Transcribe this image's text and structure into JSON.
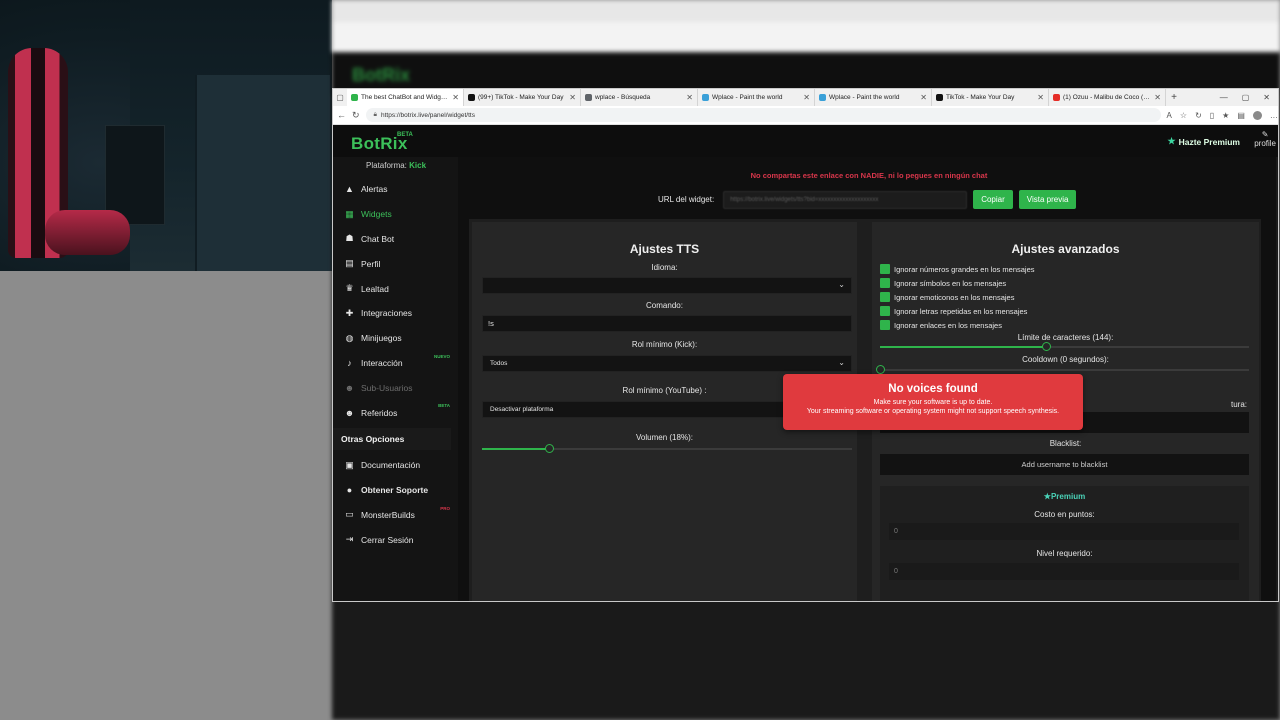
{
  "browser": {
    "tabs": [
      {
        "title": "The best ChatBot and Widgets f",
        "color": "#2fb44b",
        "active": true
      },
      {
        "title": "(99+) TikTok - Make Your Day",
        "color": "#111111",
        "active": false
      },
      {
        "title": "wplace - Búsqueda",
        "color": "#5f6368",
        "active": false
      },
      {
        "title": "Wplace - Paint the world",
        "color": "#3aa0d8",
        "active": false
      },
      {
        "title": "Wplace - Paint the world",
        "color": "#3aa0d8",
        "active": false
      },
      {
        "title": "TikTok - Make Your Day",
        "color": "#111111",
        "active": false
      },
      {
        "title": "(1) Ozuu - Malibu de Coco (Offi",
        "color": "#e52d27",
        "active": false
      }
    ],
    "url": "https://botrix.live/panel/widget/tts"
  },
  "app": {
    "logo": "BotRix",
    "logo_badge": "BETA",
    "premium_label": "Hazte Premium",
    "profile_label": "profile",
    "platform_label": "Plataforma:",
    "platform_value": "Kick"
  },
  "sidebar": {
    "items": [
      {
        "label": "Alertas",
        "icon": "warning-icon",
        "glyph": "▲"
      },
      {
        "label": "Widgets",
        "icon": "widgets-icon",
        "glyph": "▦",
        "active": true
      },
      {
        "label": "Chat Bot",
        "icon": "robot-icon",
        "glyph": "☗"
      },
      {
        "label": "Perfil",
        "icon": "id-card-icon",
        "glyph": "▤"
      },
      {
        "label": "Lealtad",
        "icon": "trophy-icon",
        "glyph": "♛"
      },
      {
        "label": "Integraciones",
        "icon": "puzzle-icon",
        "glyph": "✚"
      },
      {
        "label": "Minijuegos",
        "icon": "gamepad-icon",
        "glyph": "◍"
      },
      {
        "label": "Interacción",
        "icon": "music-icon",
        "glyph": "♪",
        "tag": "NUEVO"
      },
      {
        "label": "Sub-Usuarios",
        "icon": "users-icon",
        "glyph": "☻",
        "dim": true
      },
      {
        "label": "Referidos",
        "icon": "users-icon",
        "glyph": "☻",
        "tag": "BETA"
      }
    ],
    "other_title": "Otras Opciones",
    "other_items": [
      {
        "label": "Documentación",
        "icon": "book-icon",
        "glyph": "▣"
      },
      {
        "label": "Obtener Soporte",
        "icon": "question-icon",
        "glyph": "●",
        "bold": true
      },
      {
        "label": "MonsterBuilds",
        "icon": "laptop-icon",
        "glyph": "▭",
        "tag": "PRO"
      },
      {
        "label": "Cerrar Sesión",
        "icon": "logout-icon",
        "glyph": "⇥"
      }
    ]
  },
  "main": {
    "warning": "No compartas este enlace con NADIE, ni lo pegues en ningún chat",
    "widget_url_label": "URL del widget:",
    "widget_url_value": "https://botrix.live/widgets/tts?bid=xxxxxxxxxxxxxxxxxxxx",
    "copy_button": "Copiar",
    "preview_button": "Vista previa"
  },
  "tts": {
    "title": "Ajustes TTS",
    "idioma_label": "Idioma:",
    "idioma_value": "",
    "comando_label": "Comando:",
    "comando_value": "!s",
    "rol_kick_label": "Rol mínimo (Kick):",
    "rol_kick_value": "Todos",
    "rol_yt_label": "Rol mínimo (YouTube) :",
    "rol_yt_value": "Desactivar plataforma",
    "volumen_label": "Volumen (18%):",
    "volumen_fraction": 0.18
  },
  "advanced": {
    "title": "Ajustes avanzados",
    "checks": [
      "Ignorar números grandes en los mensajes",
      "Ignorar símbolos en los mensajes",
      "Ignorar emoticonos en los mensajes",
      "Ignorar letras repetidas en los mensajes",
      "Ignorar enlaces en los mensajes"
    ],
    "limit_label": "Límite de caracteres (144):",
    "limit_fraction": 0.45,
    "cooldown_label": "Cooldown (0 segundos):",
    "cooldown_fraction": 0,
    "hidden_label_fragment": "tura:",
    "blacklist_label": "Blacklist:",
    "blacklist_placeholder": "Add username to blacklist",
    "premium_title": "Premium",
    "cost_label": "Costo en puntos:",
    "cost_value": "0",
    "level_label": "Nivel requerido:",
    "level_value": "0"
  },
  "toast": {
    "title": "No voices found",
    "line1": "Make sure your software is up to date.",
    "line2": "Your streaming software or operating system might not support speech synthesis."
  },
  "colors": {
    "accent": "#2fb44b",
    "warning": "#d8364b",
    "toast": "#e03a3e"
  }
}
